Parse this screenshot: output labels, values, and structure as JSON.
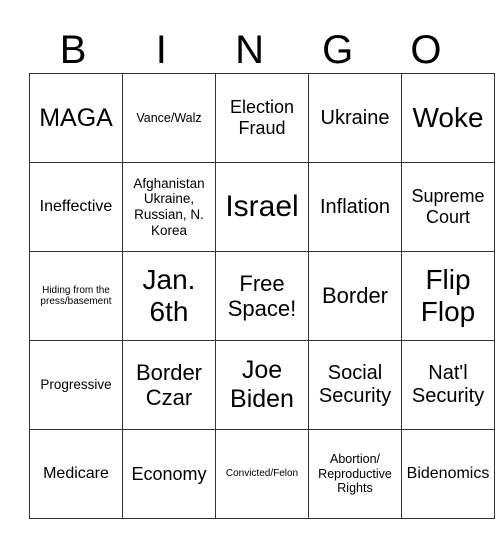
{
  "header": {
    "letters": [
      "B",
      "I",
      "N",
      "G",
      "O"
    ]
  },
  "cells": [
    [
      "MAGA",
      "Vance/Walz",
      "Election Fraud",
      "Ukraine",
      "Woke"
    ],
    [
      "Ineffective",
      "Afghanistan Ukraine, Russian, N. Korea",
      "Israel",
      "Inflation",
      "Supreme Court"
    ],
    [
      "Hiding from the press/basement",
      "Jan. 6th",
      "Free Space!",
      "Border",
      "Flip Flop"
    ],
    [
      "Progressive",
      "Border Czar",
      "Joe Biden",
      "Social Security",
      "Nat'l Security"
    ],
    [
      "Medicare",
      "Economy",
      "Convicted/Felon",
      "Abortion/ Reproductive Rights",
      "Bidenomics"
    ]
  ]
}
